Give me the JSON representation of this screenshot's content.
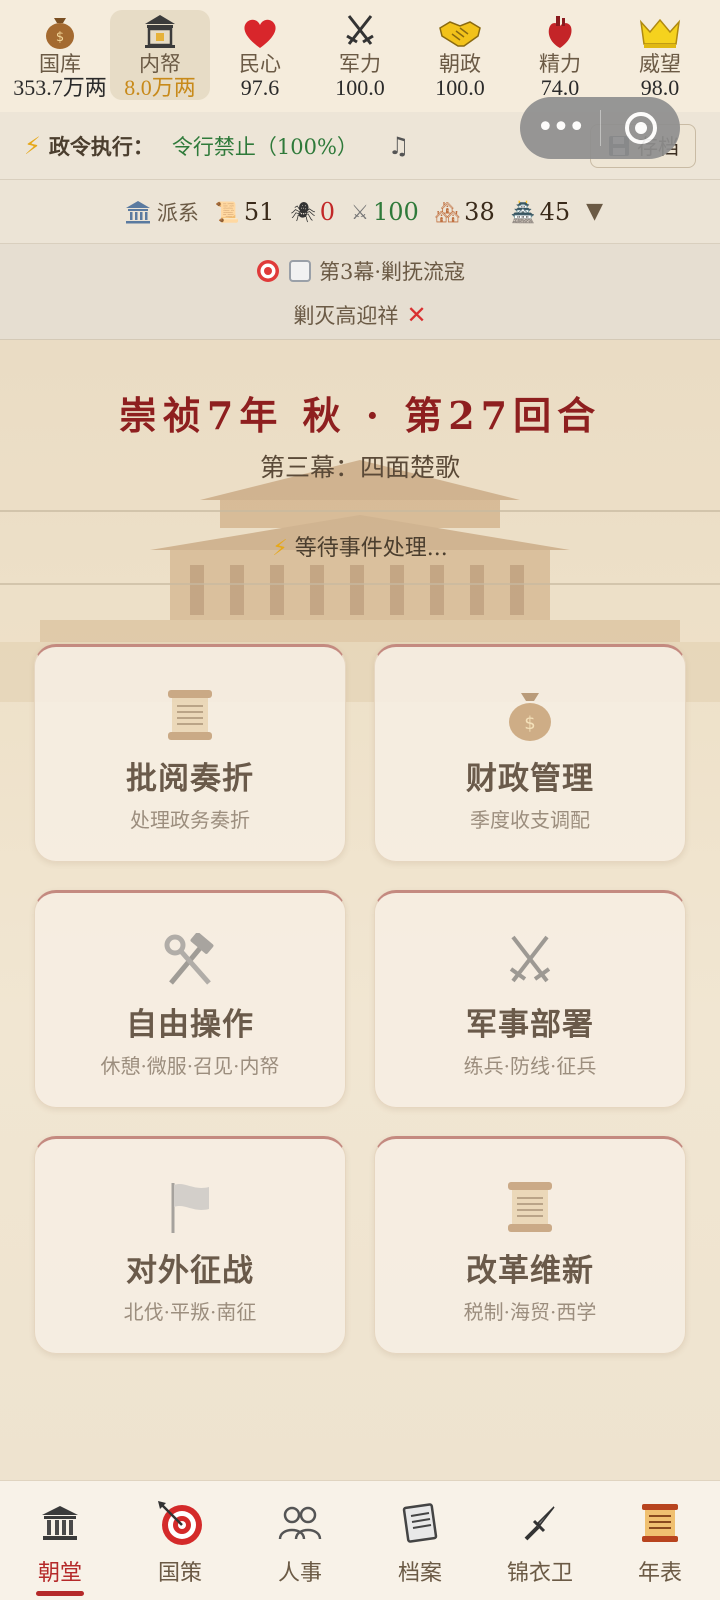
{
  "stats": [
    {
      "label": "国库",
      "value": "353.7万两",
      "icon": "money-bag-icon"
    },
    {
      "label": "内帑",
      "value": "8.0万两",
      "icon": "treasury-building-icon",
      "active": true
    },
    {
      "label": "民心",
      "value": "97.6",
      "icon": "heart-icon"
    },
    {
      "label": "军力",
      "value": "100.0",
      "icon": "crossed-swords-icon"
    },
    {
      "label": "朝政",
      "value": "100.0",
      "icon": "handshake-icon"
    },
    {
      "label": "精力",
      "value": "74.0",
      "icon": "anatomical-heart-icon"
    },
    {
      "label": "威望",
      "value": "98.0",
      "icon": "crown-icon"
    }
  ],
  "decree": {
    "label": "政令执行：",
    "value": "令行禁止（100%）",
    "icon": "lightning-icon",
    "music_icon": "music-note-icon"
  },
  "save": {
    "label": "存档",
    "icon": "floppy-disk-icon"
  },
  "capsule": {
    "more": "•••",
    "close_icon": "target-close-icon"
  },
  "faction": {
    "label": "派系",
    "items": [
      {
        "icon": "scroll-icon",
        "value": "51",
        "color": "#2a2a2a"
      },
      {
        "icon": "spider-icon",
        "value": "0",
        "color": "#c22828"
      },
      {
        "icon": "crossed-swords-icon",
        "value": "100",
        "color": "#2f7a3a"
      },
      {
        "icon": "houses-icon",
        "value": "38",
        "color": "#2a2a2a"
      },
      {
        "icon": "castle-icon",
        "value": "45",
        "color": "#2a2a2a"
      }
    ],
    "expand": "▼"
  },
  "objective": {
    "title": "第3幕·剿抚流寇",
    "task": "剿灭高迎祥",
    "status_icon": "cross-mark-icon"
  },
  "turn": {
    "title": "崇祯7年 秋 · 第27回合",
    "act": "第三幕：四面楚歌",
    "waiting": "等待事件处理..."
  },
  "cards": [
    {
      "title": "批阅奏折",
      "sub": "处理政务奏折",
      "icon": "scroll-icon"
    },
    {
      "title": "财政管理",
      "sub": "季度收支调配",
      "icon": "money-bag-icon"
    },
    {
      "title": "自由操作",
      "sub": "休憩·微服·召见·内帑",
      "icon": "hammer-wrench-icon"
    },
    {
      "title": "军事部署",
      "sub": "练兵·防线·征兵",
      "icon": "crossed-swords-icon"
    },
    {
      "title": "对外征战",
      "sub": "北伐·平叛·南征",
      "icon": "flag-icon"
    },
    {
      "title": "改革维新",
      "sub": "税制·海贸·西学",
      "icon": "scroll-icon"
    }
  ],
  "nav": [
    {
      "label": "朝堂",
      "icon": "classical-building-icon",
      "active": true
    },
    {
      "label": "国策",
      "icon": "target-arrow-icon"
    },
    {
      "label": "人事",
      "icon": "people-icon"
    },
    {
      "label": "档案",
      "icon": "document-icon"
    },
    {
      "label": "锦衣卫",
      "icon": "dagger-icon"
    },
    {
      "label": "年表",
      "icon": "scroll-icon"
    }
  ],
  "colors": {
    "accent_red": "#b52a2a",
    "gold": "#c88a1a",
    "green": "#2f7a3a",
    "title_red": "#8e1f1f"
  }
}
